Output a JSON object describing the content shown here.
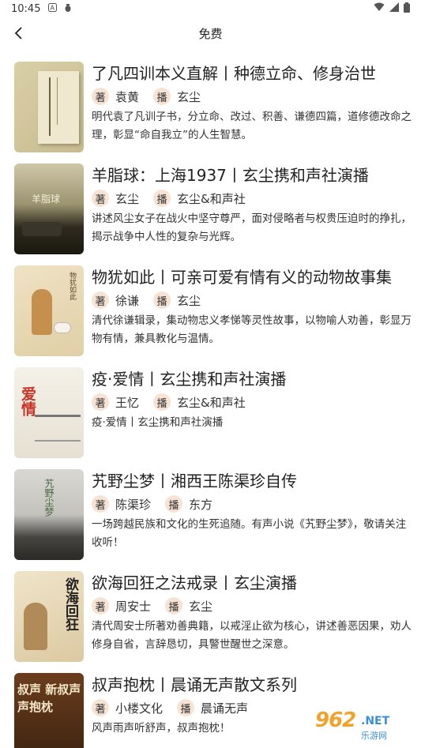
{
  "status_bar": {
    "time": "10:45",
    "icons": [
      "a-icon",
      "bug-icon"
    ],
    "right_icons": [
      "wifi-icon",
      "signal-icon",
      "battery-icon"
    ]
  },
  "header": {
    "title": "免费"
  },
  "labels": {
    "author": "著",
    "narrator": "播"
  },
  "items": [
    {
      "title": "了凡四训本义直解丨种德立命、修身治世",
      "author": "袁黄",
      "narrator": "玄尘",
      "desc": "明代袁了凡训子书，分立命、改过、积善、谦德四篇，道修德改命之理，彰显“命自我立”的人生智慧。",
      "cover_text": ""
    },
    {
      "title": "羊脂球：上海1937丨玄尘携和声社演播",
      "author": "玄尘",
      "narrator": "玄尘&和声社",
      "desc": "讲述风尘女子在战火中坚守尊严，面对侵略者与权贵压迫时的挣扎，揭示战争中人性的复杂与光辉。",
      "cover_text": "羊脂球"
    },
    {
      "title": "物犹如此丨可亲可爱有情有义的动物故事集",
      "author": "徐谦",
      "narrator": "玄尘",
      "desc": "清代徐谦辑录，集动物忠义孝悌等灵性故事，以物喻人劝善，彰显万物有情，兼具教化与温情。",
      "cover_text": "物犹如此"
    },
    {
      "title": "疫·爱情丨玄尘携和声社演播",
      "author": "王忆",
      "narrator": "玄尘&和声社",
      "desc": "疫·爱情丨玄尘携和声社演播",
      "cover_text": "爱情"
    },
    {
      "title": "艽野尘梦丨湘西王陈渠珍自传",
      "author": "陈渠珍",
      "narrator": "东方",
      "desc": "一场跨越民族和文化的生死追随。有声小说《艽野尘梦》，敬请关注收听！",
      "cover_text": "艽野尘梦"
    },
    {
      "title": "欲海回狂之法戒录丨玄尘演播",
      "author": "周安士",
      "narrator": "玄尘",
      "desc": "清代周安士所著劝善典籍，以戒淫止欲为核心，讲述善恶因果，劝人修身自省，言辞恳切，具警世醒世之深意。",
      "cover_text": "欲海回狂"
    },
    {
      "title": "叔声抱枕丨晨诵无声散文系列",
      "author": "小楼文化",
      "narrator": "晨诵无声",
      "desc": "风声雨声听舒声，叔声抱枕！",
      "cover_text": "叔声 新叔声 声抱枕"
    }
  ],
  "watermark": {
    "num": "962",
    "net": ".NET",
    "cn": "乐游网"
  },
  "colors": {
    "tag_bg": "#f6e3d4",
    "watermark_orange": "#f0a22a",
    "watermark_blue": "#3c8fd6"
  }
}
